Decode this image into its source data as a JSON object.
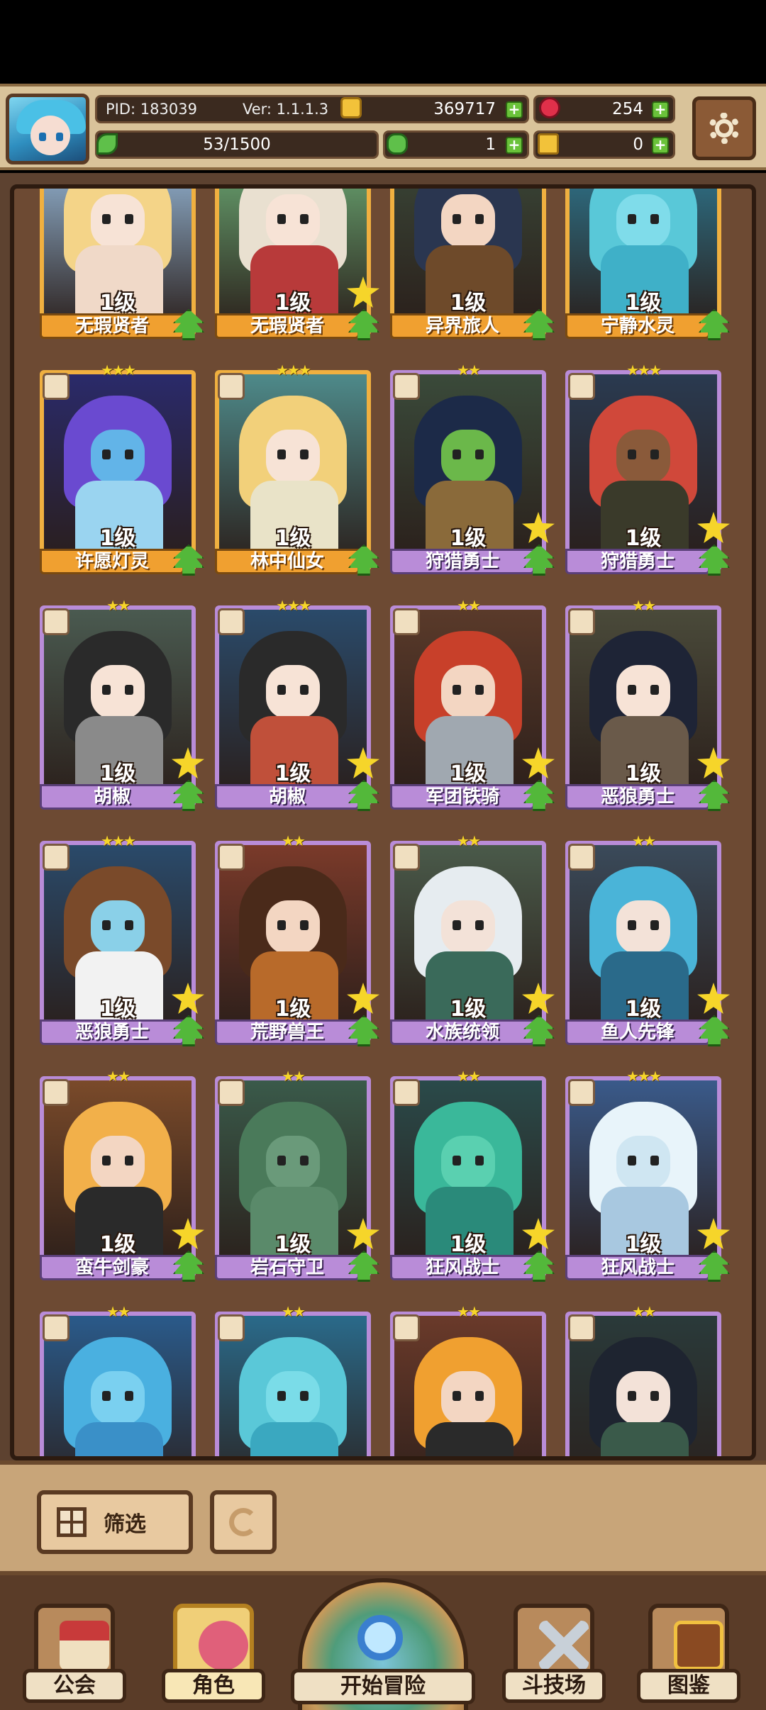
{
  "header": {
    "pid": "PID: 183039",
    "ver": "Ver: 1.1.1.3",
    "coins": "369717",
    "gems": "254",
    "exp": "53/1500",
    "clovers": "1",
    "keys": "0"
  },
  "cards": [
    {
      "level": "1级",
      "name": "无瑕贤者",
      "rarity": "gold",
      "star": false,
      "palette": [
        "#f4d488",
        "#f7e3d6",
        "#f0d9c8",
        "#9fc5e8"
      ]
    },
    {
      "level": "1级",
      "name": "无瑕贤者",
      "rarity": "gold",
      "star": true,
      "palette": [
        "#e9e0d0",
        "#f7e3d6",
        "#b83a3a",
        "#6fb37a"
      ]
    },
    {
      "level": "1级",
      "name": "异界旅人",
      "rarity": "gold",
      "star": false,
      "palette": [
        "#2a3650",
        "#f3d6c2",
        "#6e4a2a",
        "#3b4a3a"
      ]
    },
    {
      "level": "1级",
      "name": "宁静水灵",
      "rarity": "gold",
      "star": false,
      "palette": [
        "#59c8d8",
        "#7fdcea",
        "#3fb0c8",
        "#2e7f9a"
      ]
    },
    {
      "level": "1级",
      "name": "许愿灯灵",
      "rarity": "gold",
      "star": false,
      "rank": "★★★",
      "palette": [
        "#6a4ad0",
        "#62b4e8",
        "#9ad4f0",
        "#2a2a6a"
      ]
    },
    {
      "level": "1级",
      "name": "林中仙女",
      "rarity": "gold",
      "star": false,
      "rank": "★★★",
      "palette": [
        "#f2d07a",
        "#f7e3d6",
        "#e9e3c8",
        "#4e8a8a"
      ]
    },
    {
      "level": "1级",
      "name": "狩猎勇士",
      "rarity": "purple",
      "star": true,
      "rank": "★★",
      "palette": [
        "#1c2a48",
        "#6bb84a",
        "#8a6a3a",
        "#3a4a3a"
      ]
    },
    {
      "level": "1级",
      "name": "狩猎勇士",
      "rarity": "purple",
      "star": true,
      "rank": "★★★",
      "palette": [
        "#d0483a",
        "#8a5a3a",
        "#3a3a2a",
        "#2a3a50"
      ]
    },
    {
      "level": "1级",
      "name": "胡椒",
      "rarity": "purple",
      "star": true,
      "rank": "★★",
      "palette": [
        "#2a2a2a",
        "#f7e3d6",
        "#8a8a8a",
        "#4a5a50"
      ]
    },
    {
      "level": "1级",
      "name": "胡椒",
      "rarity": "purple",
      "star": true,
      "rank": "★★★",
      "palette": [
        "#2a2a2a",
        "#f7e3d6",
        "#c0503a",
        "#2a4a6a"
      ]
    },
    {
      "level": "1级",
      "name": "军团铁骑",
      "rarity": "purple",
      "star": true,
      "rank": "★★",
      "palette": [
        "#c8402a",
        "#f3d6c2",
        "#a0a8b0",
        "#5a3a2a"
      ]
    },
    {
      "level": "1级",
      "name": "恶狼勇士",
      "rarity": "purple",
      "star": true,
      "rank": "★★",
      "palette": [
        "#1e2436",
        "#f7e3d6",
        "#6a5a4a",
        "#4a4a3a"
      ]
    },
    {
      "level": "1级",
      "name": "恶狼勇士",
      "rarity": "purple",
      "star": true,
      "rank": "★★★",
      "palette": [
        "#7a4a2a",
        "#8ad0e8",
        "#f2f2f2",
        "#2a4a6a"
      ]
    },
    {
      "level": "1级",
      "name": "荒野兽王",
      "rarity": "purple",
      "star": true,
      "rank": "★★",
      "palette": [
        "#4a2a1a",
        "#f3d6c2",
        "#b86a2a",
        "#7a3a2a"
      ]
    },
    {
      "level": "1级",
      "name": "水族统领",
      "rarity": "purple",
      "star": true,
      "rank": "★★",
      "palette": [
        "#e6ecf0",
        "#f3e2d8",
        "#3a6a5a",
        "#4a5a4a"
      ]
    },
    {
      "level": "1级",
      "name": "鱼人先锋",
      "rarity": "purple",
      "star": true,
      "rank": "★★",
      "palette": [
        "#4ab4d8",
        "#f3e2d8",
        "#2a6a8a",
        "#3a4a5a"
      ]
    },
    {
      "level": "1级",
      "name": "蛮牛剑豪",
      "rarity": "purple",
      "star": true,
      "rank": "★★",
      "palette": [
        "#f2b04a",
        "#f3d6c2",
        "#2a2a2a",
        "#7a4a2a"
      ]
    },
    {
      "level": "1级",
      "name": "岩石守卫",
      "rarity": "purple",
      "star": true,
      "rank": "★★",
      "palette": [
        "#4a7a5a",
        "#6a9a7a",
        "#5a8a6a",
        "#3a5a4a"
      ]
    },
    {
      "level": "1级",
      "name": "狂风战士",
      "rarity": "purple",
      "star": true,
      "rank": "★★",
      "palette": [
        "#3ab89a",
        "#5ad0b0",
        "#2a8a7a",
        "#2a4a4a"
      ]
    },
    {
      "level": "1级",
      "name": "狂风战士",
      "rarity": "purple",
      "star": true,
      "rank": "★★★",
      "palette": [
        "#e8f4fa",
        "#cfe6f2",
        "#a8c8e0",
        "#3a5a8a"
      ]
    },
    {
      "level": "",
      "name": "",
      "rarity": "purple",
      "star": false,
      "rank": "★★",
      "palette": [
        "#4ab0e0",
        "#7ad0f0",
        "#3a90c8",
        "#2a5a8a"
      ]
    },
    {
      "level": "",
      "name": "",
      "rarity": "purple",
      "star": false,
      "rank": "★★",
      "palette": [
        "#5ac8d8",
        "#7adce8",
        "#3aa8c0",
        "#2a6a8a"
      ]
    },
    {
      "level": "",
      "name": "",
      "rarity": "purple",
      "star": false,
      "rank": "★★",
      "palette": [
        "#f0a030",
        "#f3d6c2",
        "#2a2a2a",
        "#6a3a2a"
      ]
    },
    {
      "level": "",
      "name": "",
      "rarity": "purple",
      "star": false,
      "rank": "★★",
      "palette": [
        "#1e2430",
        "#f3e2d8",
        "#3a5a4a",
        "#2a3a3a"
      ]
    }
  ],
  "controls": {
    "filter_label": "筛选"
  },
  "nav": {
    "guild": "公会",
    "character": "角色",
    "adventure": "开始冒险",
    "arena": "斗技场",
    "codex": "图鉴"
  }
}
